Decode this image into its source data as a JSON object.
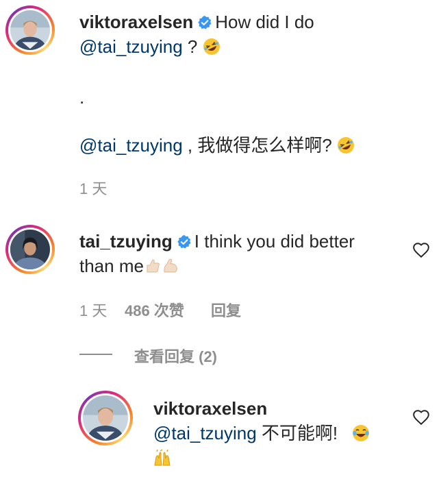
{
  "comments": [
    {
      "username": "viktoraxelsen",
      "text_1": "How did I do",
      "mention_1": "@tai_tzuying",
      "text_2": " ?",
      "dot": ".",
      "mention_2": "@tai_tzuying",
      "text_3": " , 我做得怎么样啊?",
      "time": "1 天",
      "emoji": "rofl-emoji"
    },
    {
      "username": "tai_tzuying",
      "text_1": "I think you did better",
      "text_2": "than me",
      "time": "1 天",
      "likes": "486 次赞",
      "reply": "回复",
      "view_replies": "查看回复 (2)",
      "emoji": "thumbs-up-flexed-biceps-emoji"
    }
  ],
  "reply": {
    "username": "viktoraxelsen",
    "mention": "@tai_tzuying",
    "text": " 不可能啊!",
    "emoji": "tears-of-joy-raising-hands-emoji"
  },
  "colors": {
    "text": "#262626",
    "mention": "#00376b",
    "meta": "#8e8e8e",
    "verified": "#3897f0"
  }
}
